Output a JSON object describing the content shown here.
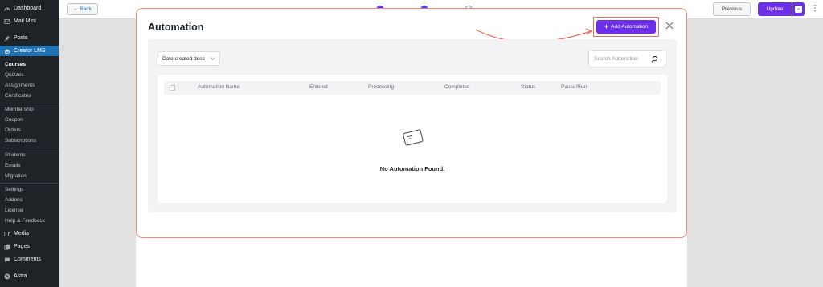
{
  "sidebar": {
    "items": [
      {
        "label": "Dashboard",
        "icon": "dashboard-icon"
      },
      {
        "label": "Mail Mint",
        "icon": "mail-icon"
      },
      {
        "label": "Posts",
        "icon": "pin-icon"
      },
      {
        "label": "Creator LMS",
        "icon": "graduation-icon"
      },
      {
        "label": "Media",
        "icon": "media-icon"
      },
      {
        "label": "Pages",
        "icon": "pages-icon"
      },
      {
        "label": "Comments",
        "icon": "comments-icon"
      },
      {
        "label": "Astra",
        "icon": "astra-icon"
      }
    ],
    "submenu": [
      "Courses",
      "Quizzes",
      "Assignments",
      "Certificates",
      "Membership",
      "Coupon",
      "Orders",
      "Subscriptions",
      "Students",
      "Emails",
      "Migration",
      "Settings",
      "Addons",
      "License",
      "Help & Feedback"
    ]
  },
  "topbar": {
    "back_label": "← Back",
    "previous_label": "Previous",
    "update_label": "Update"
  },
  "modal": {
    "title": "Automation",
    "add_button_label": "Add Automation",
    "sort_value": "Date created desc",
    "search_placeholder": "Search Automation",
    "columns": [
      "Automation Name",
      "Entered",
      "Processing",
      "Completed",
      "Status",
      "Pause/Run"
    ],
    "empty_message": "No Automation Found."
  },
  "colors": {
    "accent": "#6c2eeb",
    "highlight": "#ee6b5e",
    "sidebar_bg": "#1d2327",
    "sidebar_active": "#2271b1"
  }
}
